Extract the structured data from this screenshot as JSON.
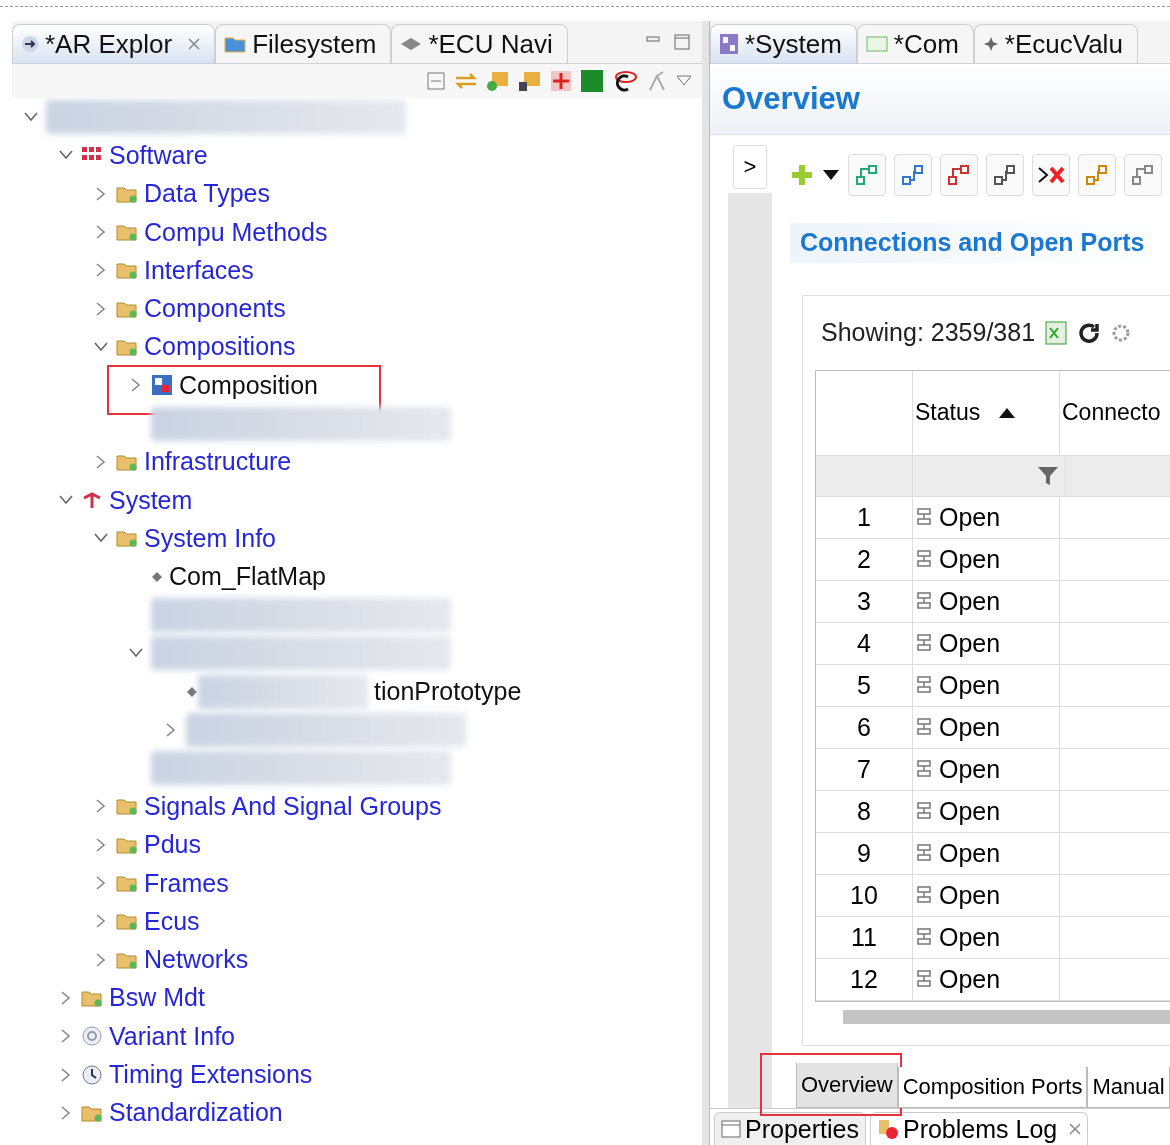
{
  "left_panel": {
    "tabs": [
      {
        "label": "*AR Explor",
        "kind": "arrow",
        "selected": true,
        "closable": true
      },
      {
        "label": "Filesystem",
        "kind": "filesystem",
        "selected": false,
        "closable": false
      },
      {
        "label": "*ECU Navi",
        "kind": "navigator",
        "selected": false,
        "closable": false
      }
    ],
    "tree": [
      {
        "kind": "blurred",
        "expanded": true,
        "children": [
          {
            "label": "Software",
            "kind": "software",
            "expanded": true,
            "children": [
              {
                "label": "Data Types",
                "kind": "folder",
                "expanded": false
              },
              {
                "label": "Compu Methods",
                "kind": "folder",
                "expanded": false
              },
              {
                "label": "Interfaces",
                "kind": "folder",
                "expanded": false
              },
              {
                "label": "Components",
                "kind": "folder",
                "expanded": false
              },
              {
                "label": "Compositions",
                "kind": "folder",
                "expanded": true,
                "children": [
                  {
                    "label": "Composition",
                    "kind": "composition",
                    "expanded": false,
                    "highlighted": true
                  },
                  {
                    "kind": "blurred"
                  }
                ]
              },
              {
                "label": "Infrastructure",
                "kind": "folder",
                "expanded": false
              }
            ]
          },
          {
            "label": "System",
            "kind": "system",
            "expanded": true,
            "children": [
              {
                "label": "System Info",
                "kind": "folder",
                "expanded": true,
                "children": [
                  {
                    "label": "Com_FlatMap",
                    "kind": "element"
                  },
                  {
                    "kind": "blurred"
                  },
                  {
                    "kind": "blurred",
                    "expanded": true,
                    "children": [
                      {
                        "label": "tionPrototype",
                        "kind": "partly_blurred"
                      },
                      {
                        "kind": "blurred",
                        "expanded": false
                      }
                    ]
                  },
                  {
                    "kind": "blurred"
                  }
                ]
              },
              {
                "label": "Signals And Signal Groups",
                "kind": "folder",
                "expanded": false
              },
              {
                "label": "Pdus",
                "kind": "folder",
                "expanded": false
              },
              {
                "label": "Frames",
                "kind": "folder",
                "expanded": false
              },
              {
                "label": "Ecus",
                "kind": "folder",
                "expanded": false
              },
              {
                "label": "Networks",
                "kind": "folder",
                "expanded": false
              }
            ]
          },
          {
            "label": "Bsw Mdt",
            "kind": "folder",
            "expanded": false
          },
          {
            "label": "Variant Info",
            "kind": "variant",
            "expanded": false
          },
          {
            "label": "Timing Extensions",
            "kind": "timing",
            "expanded": false
          },
          {
            "label": "Standardization",
            "kind": "folder",
            "expanded": false
          }
        ]
      }
    ]
  },
  "right_panel": {
    "tabs": [
      {
        "label": "*System",
        "kind": "system-editor",
        "selected": true
      },
      {
        "label": "*Com",
        "kind": "com",
        "selected": false
      },
      {
        "label": "*EcucValu",
        "kind": "ecuc",
        "selected": false
      }
    ],
    "heading": "Overview",
    "expand_button": ">",
    "section_title": "Connections and Open Ports",
    "showing": "Showing: 2359/381",
    "table": {
      "columns": [
        {
          "label": "Status",
          "sorted": true
        },
        {
          "label": "Connecto"
        }
      ],
      "rows": [
        {
          "number": "1",
          "status": "Open"
        },
        {
          "number": "2",
          "status": "Open"
        },
        {
          "number": "3",
          "status": "Open"
        },
        {
          "number": "4",
          "status": "Open"
        },
        {
          "number": "5",
          "status": "Open"
        },
        {
          "number": "6",
          "status": "Open"
        },
        {
          "number": "7",
          "status": "Open"
        },
        {
          "number": "8",
          "status": "Open"
        },
        {
          "number": "9",
          "status": "Open"
        },
        {
          "number": "10",
          "status": "Open"
        },
        {
          "number": "11",
          "status": "Open"
        },
        {
          "number": "12",
          "status": "Open"
        }
      ]
    },
    "page_tabs": [
      {
        "label": "Overview",
        "selected": true,
        "highlighted": true
      },
      {
        "label": "Composition Ports",
        "selected": false,
        "highlighted": false
      },
      {
        "label": "Manual",
        "selected": false,
        "highlighted": false
      }
    ]
  },
  "bottom_tabs": [
    {
      "label": "Properties",
      "kind": "properties",
      "selected": false,
      "closable": false
    },
    {
      "label": "Problems Log",
      "kind": "problems",
      "selected": true,
      "closable": true
    }
  ]
}
